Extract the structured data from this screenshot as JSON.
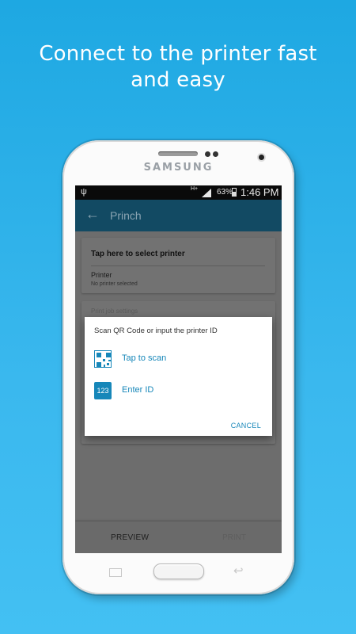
{
  "headline": {
    "line1": "Connect to the printer fast",
    "line2": "and easy"
  },
  "device": {
    "brand": "SAMSUNG"
  },
  "status_bar": {
    "network": "H+",
    "battery": "63%",
    "time": "1:46 PM"
  },
  "app_bar": {
    "title": "Princh",
    "back_icon": "arrow-left-icon"
  },
  "printer_card": {
    "select_label": "Tap here to select printer",
    "printer_label": "Printer",
    "printer_value": "No printer selected"
  },
  "job_card": {
    "hint": "Print job settings"
  },
  "dialog": {
    "title": "Scan QR Code or input the printer ID",
    "options": [
      {
        "icon": "qr-code-icon",
        "label": "Tap to scan"
      },
      {
        "icon": "number-pad-icon",
        "icon_text": "123",
        "label": "Enter ID"
      }
    ],
    "cancel_label": "CANCEL"
  },
  "bottom_bar": {
    "preview_label": "PREVIEW",
    "print_label": "PRINT"
  },
  "colors": {
    "accent": "#1787b9",
    "appbar": "#124a63",
    "background": "#2aaee8"
  }
}
